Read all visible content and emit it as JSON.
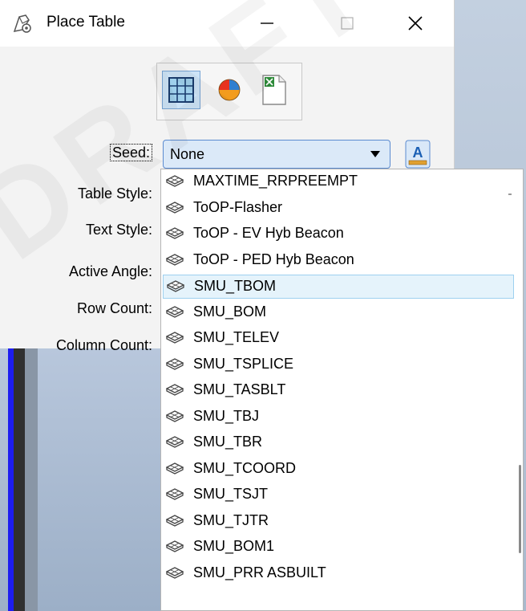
{
  "window": {
    "title": "Place Table",
    "minimize_symbol": "—",
    "maximize_symbol": "☐",
    "close_symbol": "✕"
  },
  "toolbar": {
    "tools": [
      {
        "icon": "table-grid-icon",
        "selected": true
      },
      {
        "icon": "pie-chart-icon",
        "selected": false
      },
      {
        "icon": "excel-file-icon",
        "selected": false
      }
    ]
  },
  "form": {
    "seed_label": "Seed:",
    "seed_value": "None",
    "table_style_label": "Table Style:",
    "text_style_label": "Text Style:",
    "active_angle_label": "Active Angle:",
    "row_count_label": "Row Count:",
    "column_count_label": "Column Count:",
    "font_button_letter": "A"
  },
  "dropdown": {
    "highlighted_index": 4,
    "items": [
      "MAXTIME_RRPREEMPT",
      "ToOP-Flasher",
      "ToOP - EV Hyb Beacon",
      "ToOP - PED Hyb Beacon",
      "SMU_TBOM",
      "SMU_BOM",
      "SMU_TELEV",
      "SMU_TSPLICE",
      "SMU_TASBLT",
      "SMU_TBJ",
      "SMU_TBR",
      "SMU_TCOORD",
      "SMU_TSJT",
      "SMU_TJTR",
      "SMU_BOM1",
      "SMU_PRR ASBUILT"
    ]
  },
  "watermark": "DRAFT",
  "colors": {
    "highlight_bg": "#e5f3fb",
    "highlight_border": "#9ed0ef",
    "combo_bg": "#dbe9f8",
    "combo_border": "#5b8bd0"
  }
}
